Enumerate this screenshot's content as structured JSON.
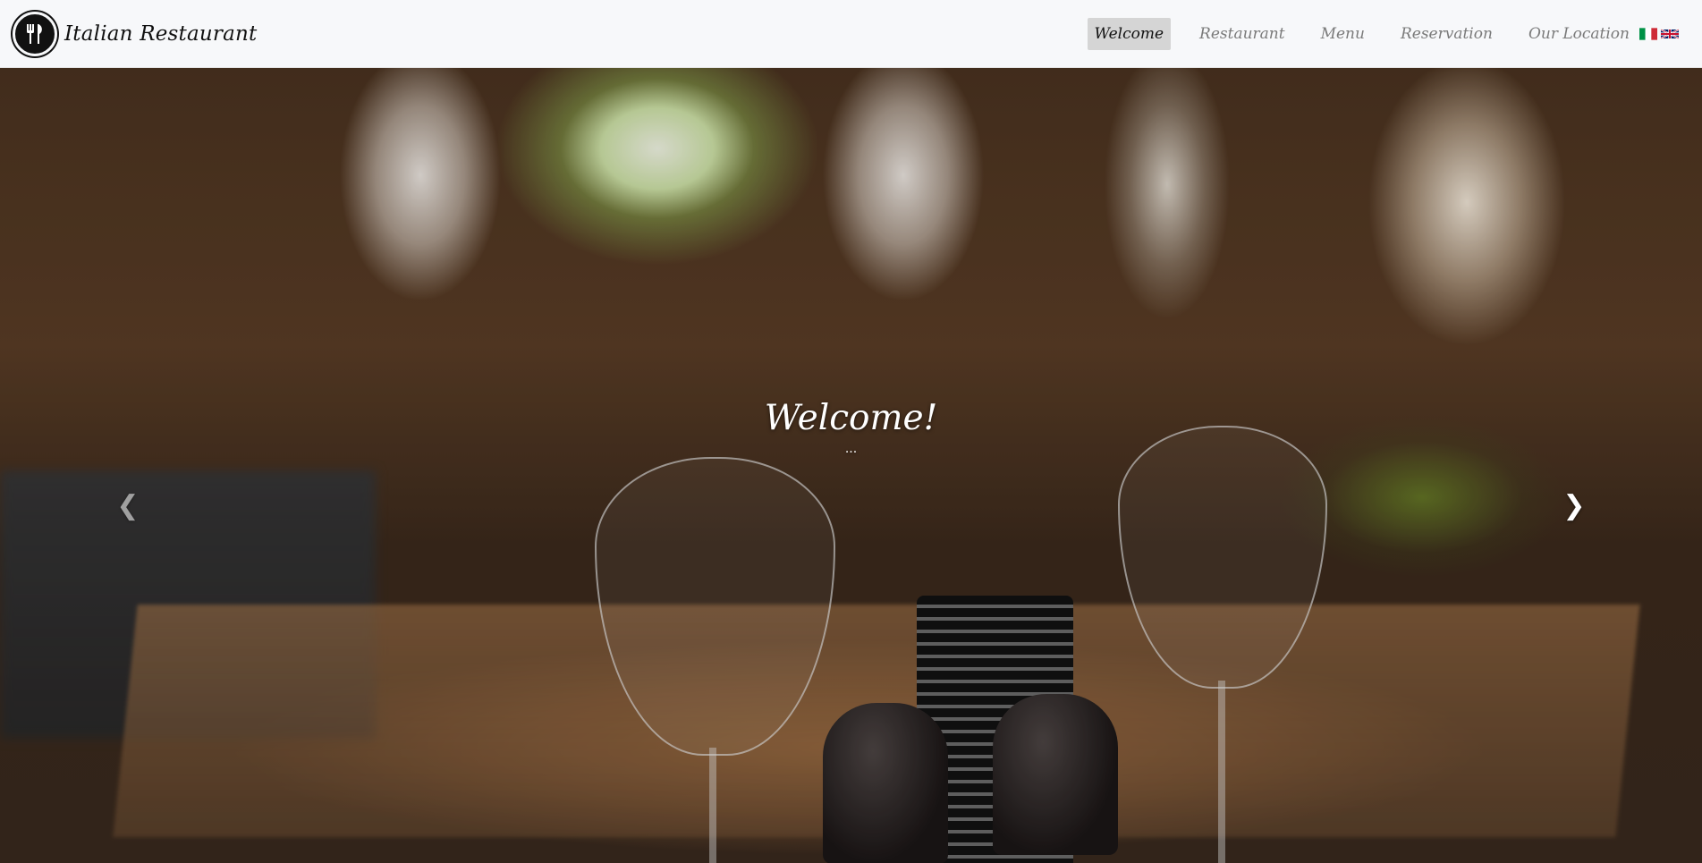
{
  "brand": {
    "name": "Italian Restaurant",
    "logo_icon": "fork-knife-icon"
  },
  "nav": {
    "items": [
      {
        "label": "Welcome",
        "active": true
      },
      {
        "label": "Restaurant",
        "active": false
      },
      {
        "label": "Menu",
        "active": false
      },
      {
        "label": "Reservation",
        "active": false
      },
      {
        "label": "Our Location",
        "active": false
      }
    ],
    "languages": [
      "italian-flag-icon",
      "uk-flag-icon"
    ]
  },
  "carousel": {
    "title": "Welcome!",
    "subtitle": "...",
    "prev_icon": "chevron-left-icon",
    "next_icon": "chevron-right-icon",
    "prev_glyph": "❮",
    "next_glyph": "❯"
  },
  "colors": {
    "navbar_bg": "#f7f8fa",
    "active_nav_bg": "#d5d5d5",
    "nav_text": "#7a7a7a"
  }
}
